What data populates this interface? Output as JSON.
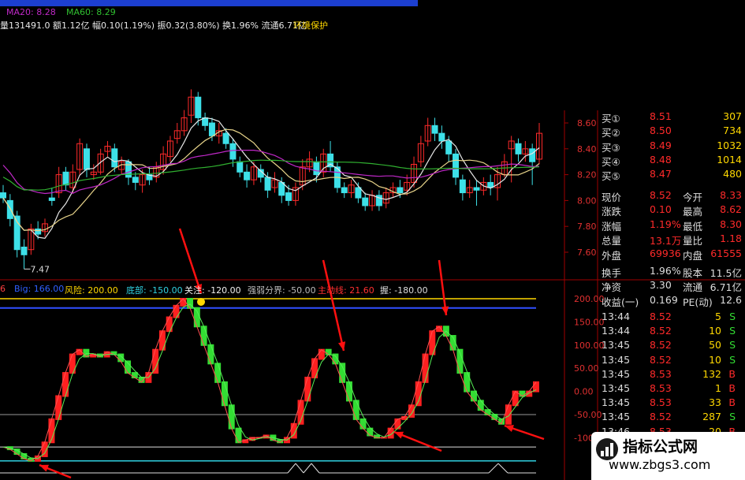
{
  "header": {
    "ma20": "MA20: 8.28",
    "ma60": "MA60: 8.29",
    "stats_line": "量131491.0 额1.12亿 幅0.10(1.19%) 振0.32(3.80%) 换1.96% 流通6.71亿",
    "protect": "环境保护"
  },
  "price_axis": [
    "8.60",
    "8.40",
    "8.20",
    "8.00",
    "7.80",
    "7.60"
  ],
  "low_label": "7.47",
  "indicator_bar": {
    "item1": "6",
    "item2": "Big: 166.00",
    "risk": "风险: 200.00",
    "bottom": "底部: -150.00",
    "focus": "关注: -120.00",
    "strong_weak": "强弱分界: -50.00",
    "main_line": "主动线: 21.60",
    "extra": "握: -180.00"
  },
  "indicator_axis": [
    "200.00",
    "150.00",
    "100.00",
    "50.00",
    "0.00",
    "-50.00",
    "-100"
  ],
  "order_book": [
    {
      "label": "买①",
      "price": "8.51",
      "vol": "307"
    },
    {
      "label": "买②",
      "price": "8.50",
      "vol": "734"
    },
    {
      "label": "买③",
      "price": "8.49",
      "vol": "1032"
    },
    {
      "label": "买④",
      "price": "8.48",
      "vol": "1014"
    },
    {
      "label": "买⑤",
      "price": "8.47",
      "vol": "480"
    }
  ],
  "quote": [
    {
      "l1": "现价",
      "v1": "8.52",
      "l2": "今开",
      "v2": "8.33"
    },
    {
      "l1": "涨跌",
      "v1": "0.10",
      "l2": "最高",
      "v2": "8.62"
    },
    {
      "l1": "涨幅",
      "v1": "1.19%",
      "l2": "最低",
      "v2": "8.30"
    },
    {
      "l1": "总量",
      "v1": "13.1万",
      "l2": "量比",
      "v2": "1.18"
    },
    {
      "l1": "外盘",
      "v1": "69936",
      "l2": "内盘",
      "v2": "61555"
    }
  ],
  "stats": [
    {
      "l1": "换手",
      "v1": "1.96%",
      "l2": "股本",
      "v2": "11.5亿"
    },
    {
      "l1": "净资",
      "v1": "3.30",
      "l2": "流通",
      "v2": "6.71亿"
    },
    {
      "l1": "收益(一)",
      "v1": "0.169",
      "l2": "PE(动)",
      "v2": "12.6"
    }
  ],
  "ticks": [
    {
      "time": "13:44",
      "price": "8.52",
      "vol": "5",
      "side": "S"
    },
    {
      "time": "13:44",
      "price": "8.52",
      "vol": "10",
      "side": "S"
    },
    {
      "time": "13:45",
      "price": "8.52",
      "vol": "50",
      "side": "S"
    },
    {
      "time": "13:45",
      "price": "8.52",
      "vol": "10",
      "side": "S"
    },
    {
      "time": "13:45",
      "price": "8.53",
      "vol": "132",
      "side": "B"
    },
    {
      "time": "13:45",
      "price": "8.53",
      "vol": "1",
      "side": "B"
    },
    {
      "time": "13:45",
      "price": "8.53",
      "vol": "33",
      "side": "B"
    },
    {
      "time": "13:45",
      "price": "8.52",
      "vol": "287",
      "side": "S"
    },
    {
      "time": "13:46",
      "price": "8.53",
      "vol": "20",
      "side": "B"
    }
  ],
  "watermark": {
    "title": "指标公式网",
    "url": "www.zbgs3.com"
  },
  "colors": {
    "up": "#ff2a2a",
    "down": "#3de0e8",
    "ind_up": "#ff2020",
    "ind_down": "#33dd33",
    "yellow": "#ffd800",
    "ma5": "#e6e6e6",
    "ma10": "#e8d48a",
    "ma20": "#c028c8",
    "ma60": "#30b030"
  }
}
